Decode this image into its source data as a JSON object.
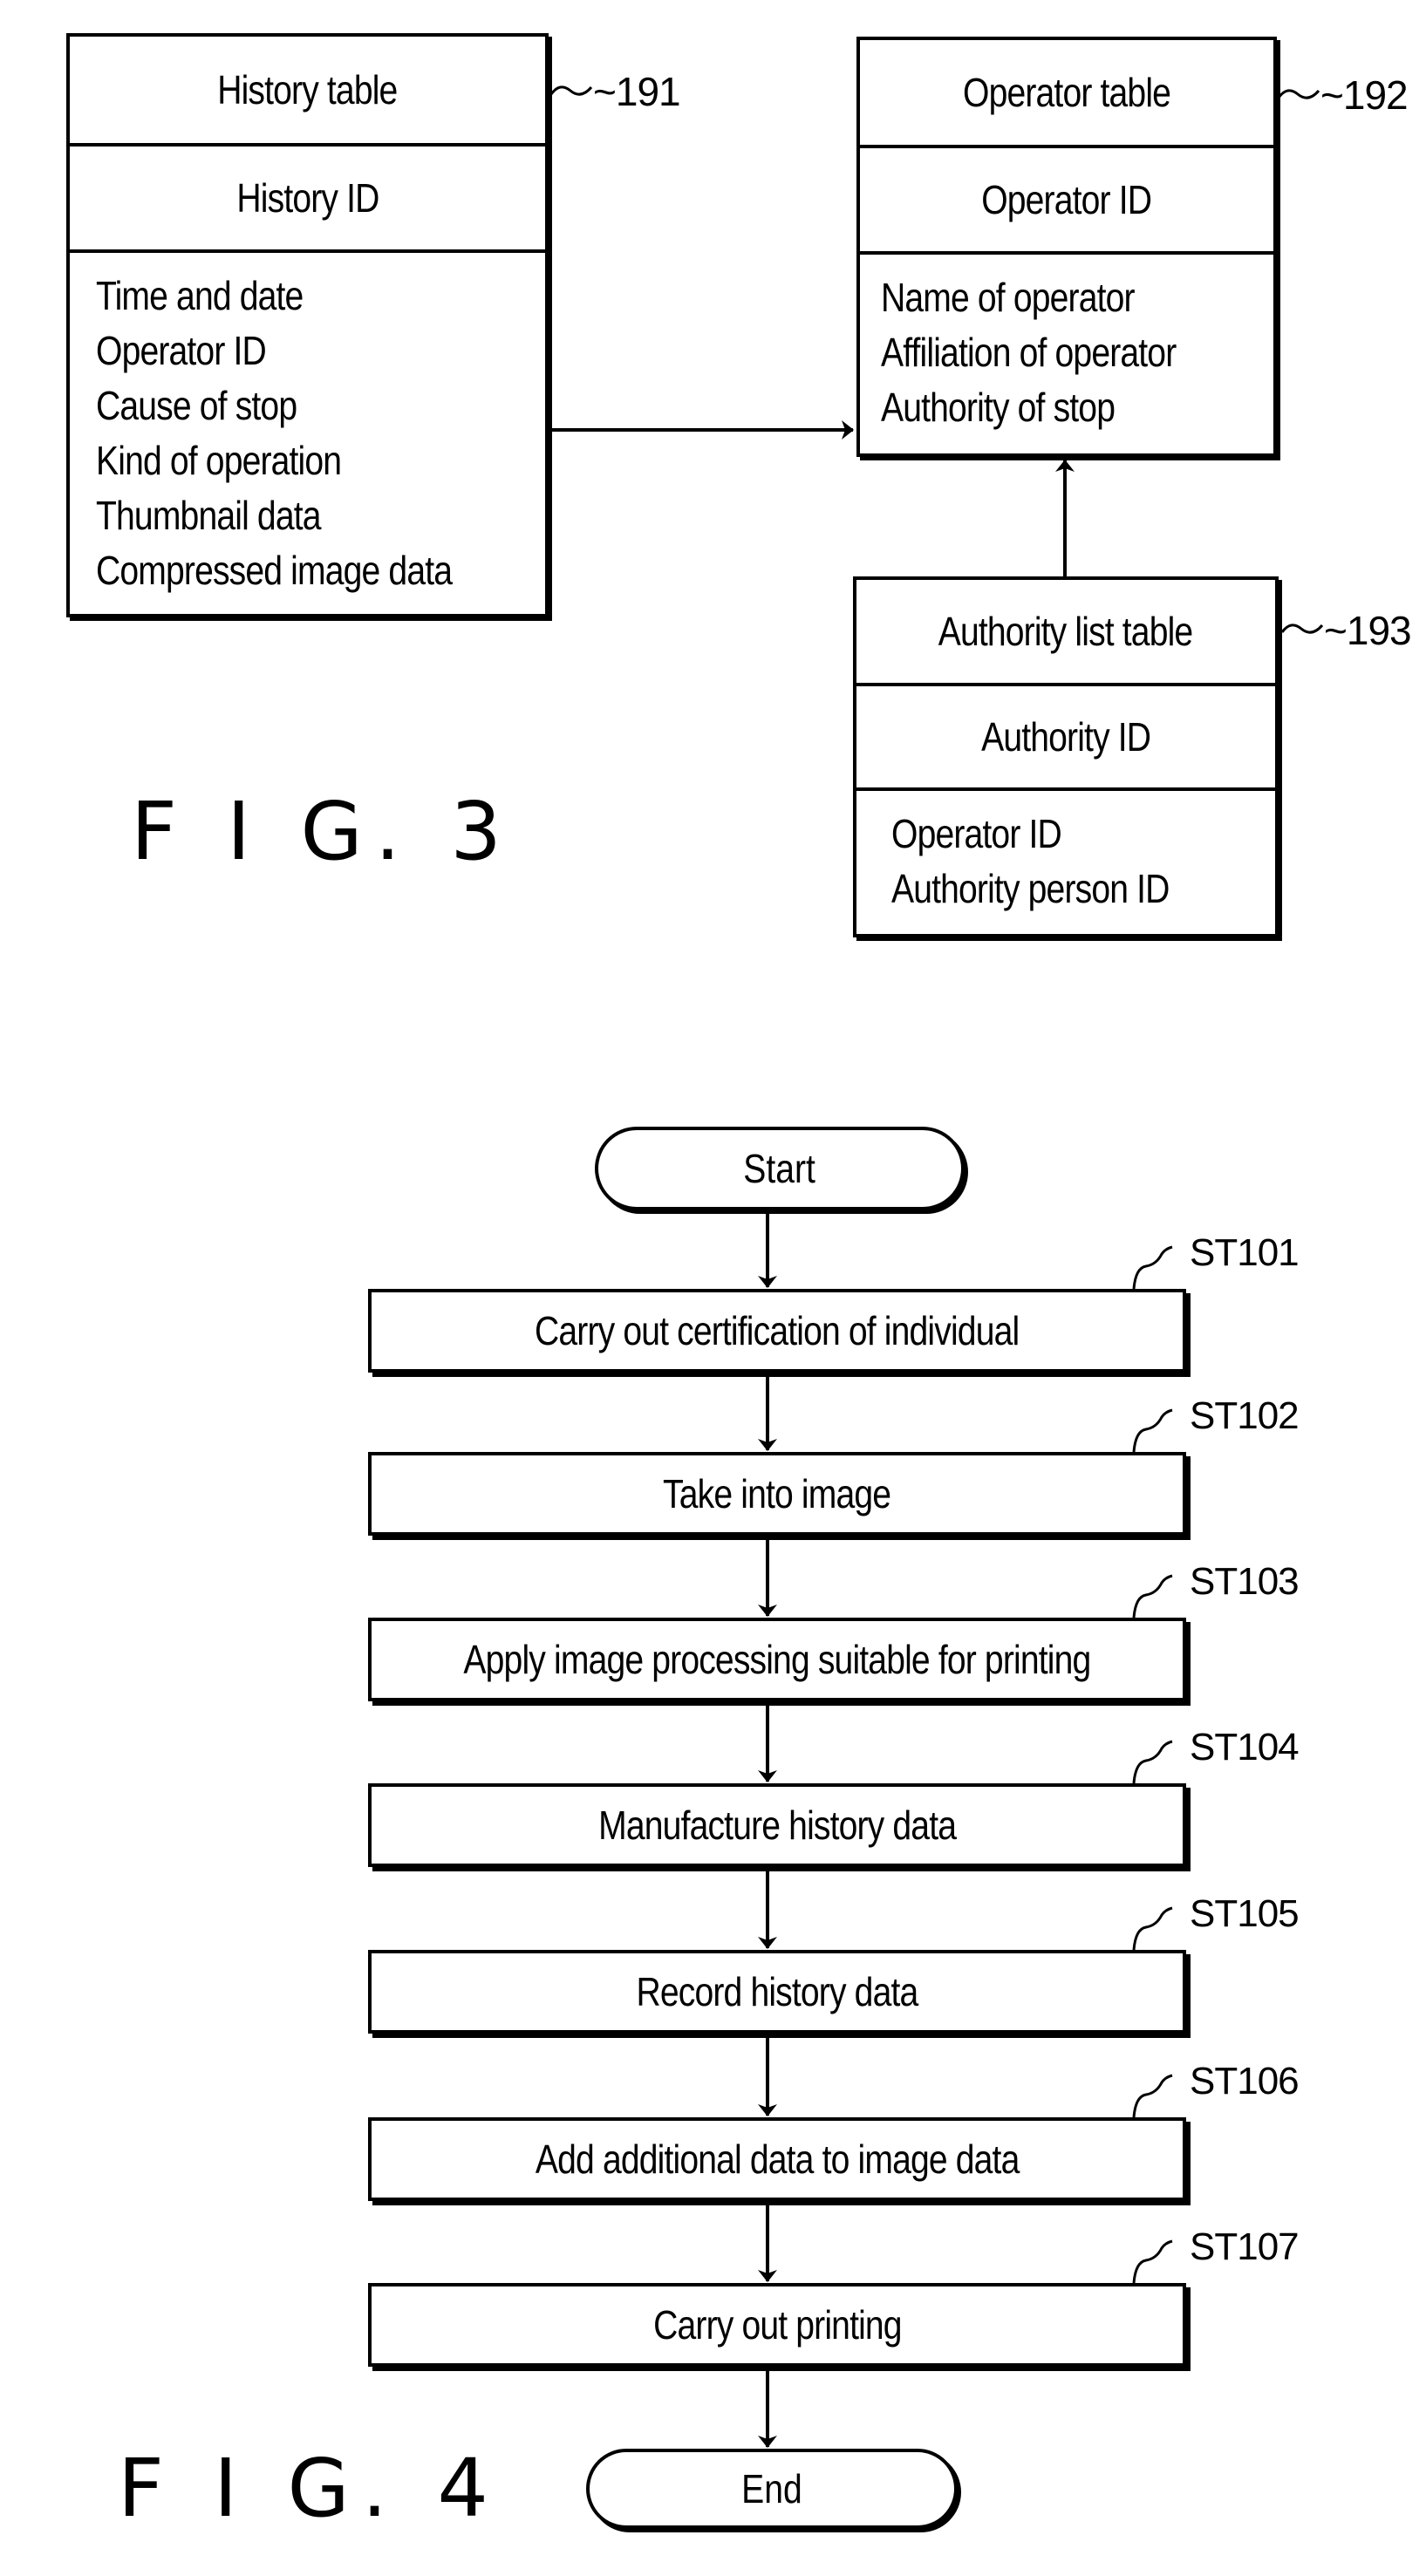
{
  "fig3": {
    "caption": "F I G. 3",
    "history_table": {
      "ref": "~191",
      "title": "History table",
      "key": "History ID",
      "fields": [
        "Time and date",
        "Operator ID",
        "Cause of stop",
        "Kind of operation",
        "Thumbnail data",
        "Compressed image data"
      ]
    },
    "operator_table": {
      "ref": "~192",
      "title": "Operator table",
      "key": "Operator ID",
      "fields": [
        "Name of operator",
        "Affiliation of operator",
        "Authority of stop"
      ]
    },
    "authority_table": {
      "ref": "~193",
      "title": "Authority list table",
      "key": "Authority ID",
      "fields": [
        "Operator ID",
        "Authority person ID"
      ]
    },
    "relations": [
      {
        "from": "history_table",
        "to": "operator_table",
        "via": "Operator ID"
      },
      {
        "from": "authority_table",
        "to": "operator_table",
        "via": "Operator ID"
      }
    ]
  },
  "fig4": {
    "caption": "F I G. 4",
    "start": "Start",
    "end": "End",
    "steps": [
      {
        "id": "ST101",
        "text": "Carry out certification of individual"
      },
      {
        "id": "ST102",
        "text": "Take into image"
      },
      {
        "id": "ST103",
        "text": "Apply image processing suitable for printing"
      },
      {
        "id": "ST104",
        "text": "Manufacture history data"
      },
      {
        "id": "ST105",
        "text": "Record history data"
      },
      {
        "id": "ST106",
        "text": "Add additional data to image data"
      },
      {
        "id": "ST107",
        "text": "Carry out printing"
      }
    ]
  }
}
